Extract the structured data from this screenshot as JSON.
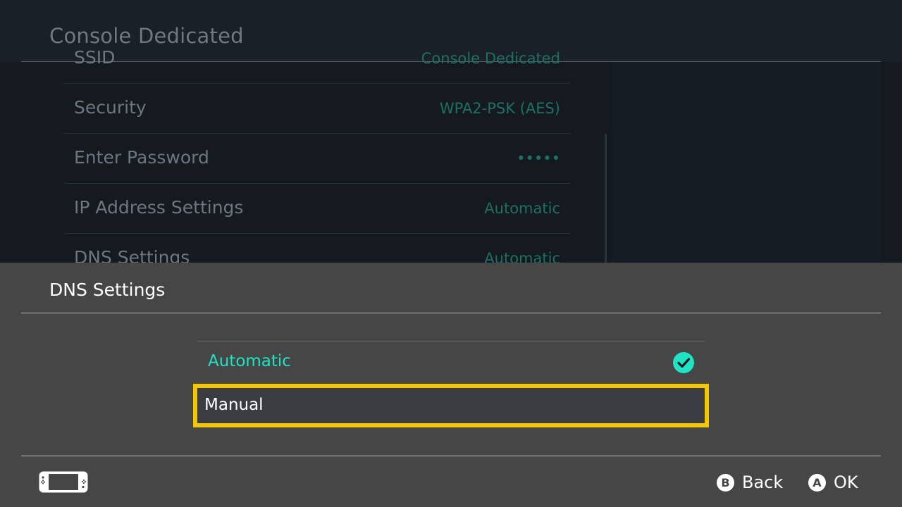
{
  "background": {
    "title": "Console Dedicated",
    "rows": [
      {
        "label": "SSID",
        "value": "Console Dedicated"
      },
      {
        "label": "Security",
        "value": "WPA2-PSK (AES)"
      },
      {
        "label": "Enter Password",
        "value": "•••••"
      },
      {
        "label": "IP Address Settings",
        "value": "Automatic"
      },
      {
        "label": "DNS Settings",
        "value": "Automatic"
      }
    ]
  },
  "dialog": {
    "title": "DNS Settings",
    "options": [
      {
        "label": "Automatic",
        "selected": true
      },
      {
        "label": "Manual",
        "focused": true
      }
    ]
  },
  "footer": {
    "back": {
      "glyph": "B",
      "label": "Back"
    },
    "ok": {
      "glyph": "A",
      "label": "OK"
    }
  },
  "colors": {
    "accent": "#1fe3c3",
    "focus": "#f2c600",
    "sheet": "#464646"
  }
}
